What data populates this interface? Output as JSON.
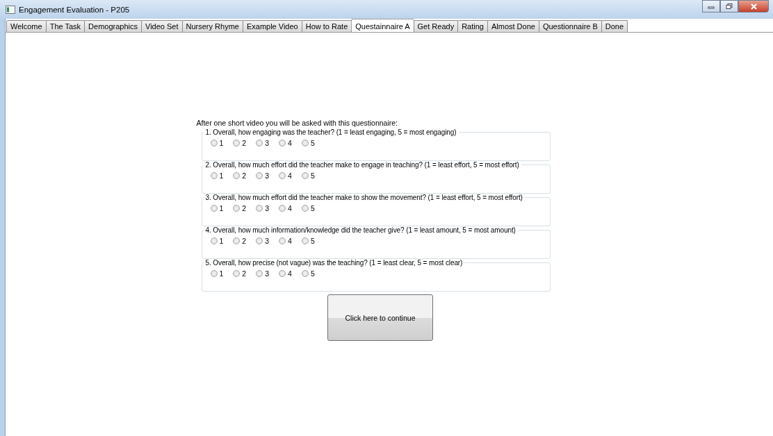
{
  "window": {
    "title": "Engagement Evaluation - P205"
  },
  "tabs": [
    {
      "label": "Welcome",
      "selected": false
    },
    {
      "label": "The Task",
      "selected": false
    },
    {
      "label": "Demographics",
      "selected": false
    },
    {
      "label": "Video Set",
      "selected": false
    },
    {
      "label": "Nursery Rhyme",
      "selected": false
    },
    {
      "label": "Example Video",
      "selected": false
    },
    {
      "label": "How to Rate",
      "selected": false
    },
    {
      "label": "Questainnaire A",
      "selected": true
    },
    {
      "label": "Get Ready",
      "selected": false
    },
    {
      "label": "Rating",
      "selected": false
    },
    {
      "label": "Almost Done",
      "selected": false
    },
    {
      "label": "Questionnaire B",
      "selected": false
    },
    {
      "label": "Done",
      "selected": false
    }
  ],
  "intro": "After one short video you will be asked with this questionnaire:",
  "questions": [
    {
      "text": "1. Overall, how engaging was the teacher? (1 = least engaging, 5 = most engaging)",
      "options": [
        {
          "label": "1",
          "selected": false
        },
        {
          "label": "2",
          "selected": false
        },
        {
          "label": "3",
          "selected": false
        },
        {
          "label": "4",
          "selected": false
        },
        {
          "label": "5",
          "selected": false
        }
      ]
    },
    {
      "text": "2. Overall, how much effort did the teacher make to engage in teaching? (1 = least effort, 5 = most effort)",
      "options": [
        {
          "label": "1",
          "selected": false
        },
        {
          "label": "2",
          "selected": false
        },
        {
          "label": "3",
          "selected": false
        },
        {
          "label": "4",
          "selected": false
        },
        {
          "label": "5",
          "selected": false
        }
      ]
    },
    {
      "text": "3. Overall, how much effort did the teacher make to show the movement? (1 = least effort, 5 = most effort)",
      "options": [
        {
          "label": "1",
          "selected": false
        },
        {
          "label": "2",
          "selected": false
        },
        {
          "label": "3",
          "selected": false
        },
        {
          "label": "4",
          "selected": false
        },
        {
          "label": "5",
          "selected": false
        }
      ]
    },
    {
      "text": "4. Overall, how much information/knowledge did the teacher give? (1 = least amount, 5 = most amount)",
      "options": [
        {
          "label": "1",
          "selected": false
        },
        {
          "label": "2",
          "selected": false
        },
        {
          "label": "3",
          "selected": false
        },
        {
          "label": "4",
          "selected": false
        },
        {
          "label": "5",
          "selected": false
        }
      ]
    },
    {
      "text": "5. Overall, how precise (not vague) was the teaching? (1 = least clear, 5 = most clear)",
      "options": [
        {
          "label": "1",
          "selected": false
        },
        {
          "label": "2",
          "selected": false
        },
        {
          "label": "3",
          "selected": false
        },
        {
          "label": "4",
          "selected": false
        },
        {
          "label": "5",
          "selected": false
        }
      ]
    }
  ],
  "continue_button": "Click here to continue"
}
